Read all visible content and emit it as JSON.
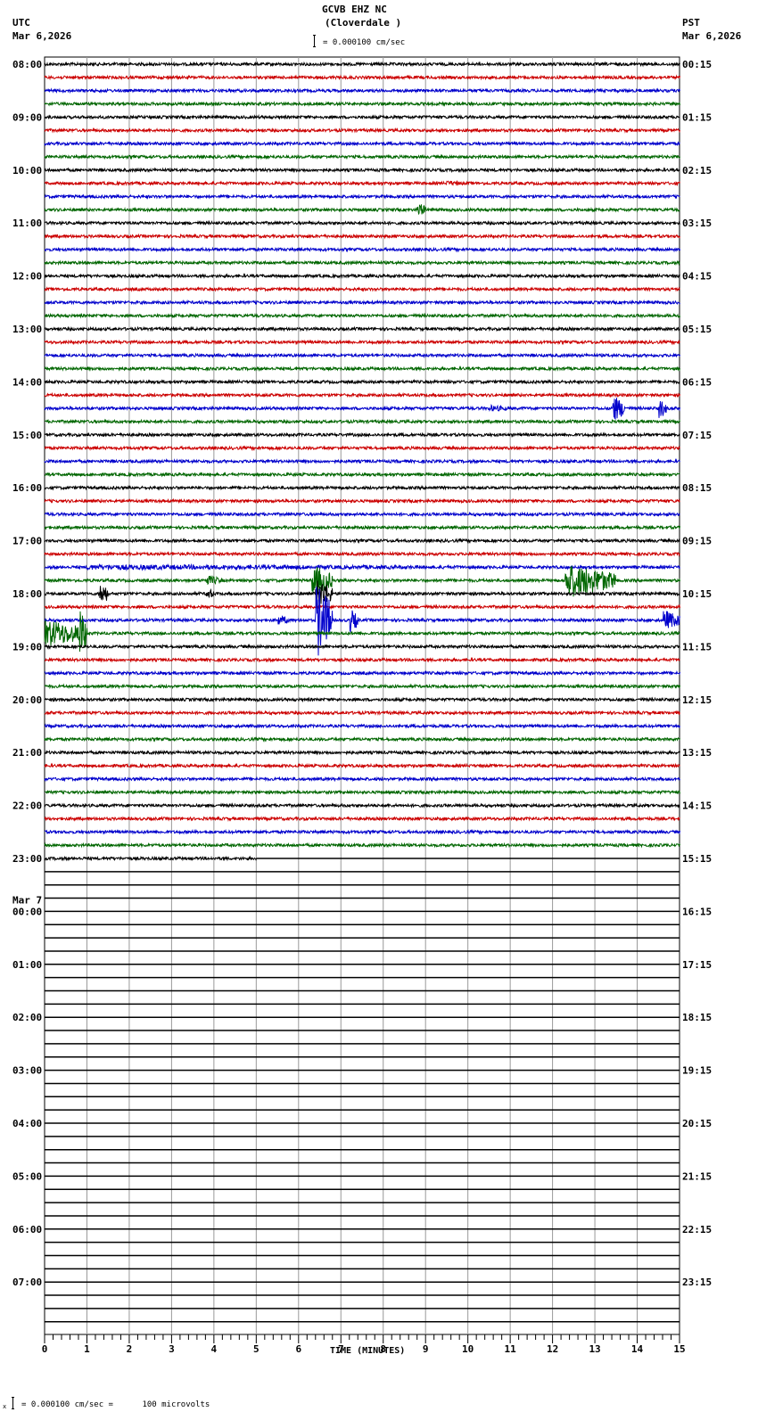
{
  "header": {
    "station": "GCVB EHZ NC",
    "location": "(Cloverdale )",
    "left_tz": "UTC",
    "left_date": "Mar 6,2026",
    "right_tz": "PST",
    "right_date": "Mar 6,2026",
    "scale": "= 0.000100 cm/sec"
  },
  "footer": {
    "scale": "= 0.000100 cm/sec =      100 microvolts",
    "prefix": "x"
  },
  "chart_data": {
    "type": "line",
    "subtype": "helicorder",
    "title": "GCVB EHZ NC (Cloverdale )",
    "xlabel": "TIME (MINUTES)",
    "xlim": [
      0,
      15
    ],
    "x_ticks": [
      "0",
      "1",
      "2",
      "3",
      "4",
      "5",
      "6",
      "7",
      "8",
      "9",
      "10",
      "11",
      "12",
      "13",
      "14",
      "15"
    ],
    "rows_total": 96,
    "rows_per_hour": 4,
    "trace_colors": [
      "#000000",
      "#cc0000",
      "#0000cc",
      "#006600"
    ],
    "rows_with_data": 61,
    "last_row_end_minute": 5,
    "left_labels": [
      {
        "row": 0,
        "text": "08:00"
      },
      {
        "row": 4,
        "text": "09:00"
      },
      {
        "row": 8,
        "text": "10:00"
      },
      {
        "row": 12,
        "text": "11:00"
      },
      {
        "row": 16,
        "text": "12:00"
      },
      {
        "row": 20,
        "text": "13:00"
      },
      {
        "row": 24,
        "text": "14:00"
      },
      {
        "row": 28,
        "text": "15:00"
      },
      {
        "row": 32,
        "text": "16:00"
      },
      {
        "row": 36,
        "text": "17:00"
      },
      {
        "row": 40,
        "text": "18:00"
      },
      {
        "row": 44,
        "text": "19:00"
      },
      {
        "row": 48,
        "text": "20:00"
      },
      {
        "row": 52,
        "text": "21:00"
      },
      {
        "row": 56,
        "text": "22:00"
      },
      {
        "row": 60,
        "text": "23:00"
      },
      {
        "row": 64,
        "text": "00:00",
        "date": "Mar 7"
      },
      {
        "row": 68,
        "text": "01:00"
      },
      {
        "row": 72,
        "text": "02:00"
      },
      {
        "row": 76,
        "text": "03:00"
      },
      {
        "row": 80,
        "text": "04:00"
      },
      {
        "row": 84,
        "text": "05:00"
      },
      {
        "row": 88,
        "text": "06:00"
      },
      {
        "row": 92,
        "text": "07:00"
      }
    ],
    "right_labels": [
      {
        "row": 0,
        "text": "00:15"
      },
      {
        "row": 4,
        "text": "01:15"
      },
      {
        "row": 8,
        "text": "02:15"
      },
      {
        "row": 12,
        "text": "03:15"
      },
      {
        "row": 16,
        "text": "04:15"
      },
      {
        "row": 20,
        "text": "05:15"
      },
      {
        "row": 24,
        "text": "06:15"
      },
      {
        "row": 28,
        "text": "07:15"
      },
      {
        "row": 32,
        "text": "08:15"
      },
      {
        "row": 36,
        "text": "09:15"
      },
      {
        "row": 40,
        "text": "10:15"
      },
      {
        "row": 44,
        "text": "11:15"
      },
      {
        "row": 48,
        "text": "12:15"
      },
      {
        "row": 52,
        "text": "13:15"
      },
      {
        "row": 56,
        "text": "14:15"
      },
      {
        "row": 60,
        "text": "15:15"
      },
      {
        "row": 64,
        "text": "16:15"
      },
      {
        "row": 68,
        "text": "17:15"
      },
      {
        "row": 72,
        "text": "18:15"
      },
      {
        "row": 76,
        "text": "19:15"
      },
      {
        "row": 80,
        "text": "20:15"
      },
      {
        "row": 84,
        "text": "21:15"
      },
      {
        "row": 88,
        "text": "22:15"
      },
      {
        "row": 92,
        "text": "23:15"
      }
    ],
    "events": [
      {
        "row": 9,
        "minute": 9.5,
        "duration": 0.5,
        "amplitude": 3
      },
      {
        "row": 11,
        "minute": 8.8,
        "duration": 0.2,
        "amplitude": 9
      },
      {
        "row": 26,
        "minute": 10.5,
        "duration": 0.5,
        "amplitude": 4
      },
      {
        "row": 26,
        "minute": 13.4,
        "duration": 0.3,
        "amplitude": 16
      },
      {
        "row": 26,
        "minute": 14.5,
        "duration": 0.2,
        "amplitude": 12
      },
      {
        "row": 38,
        "minute": 1.0,
        "duration": 13,
        "amplitude": 3
      },
      {
        "row": 39,
        "minute": 6.3,
        "duration": 0.5,
        "amplitude": 18
      },
      {
        "row": 39,
        "minute": 12.3,
        "duration": 1.2,
        "amplitude": 20
      },
      {
        "row": 39,
        "minute": 3.8,
        "duration": 0.4,
        "amplitude": 6
      },
      {
        "row": 40,
        "minute": 1.3,
        "duration": 0.2,
        "amplitude": 14
      },
      {
        "row": 40,
        "minute": 6.4,
        "duration": 0.4,
        "amplitude": 18
      },
      {
        "row": 40,
        "minute": 3.8,
        "duration": 0.2,
        "amplitude": 7
      },
      {
        "row": 42,
        "minute": 6.4,
        "duration": 0.4,
        "amplitude": 45
      },
      {
        "row": 42,
        "minute": 7.2,
        "duration": 0.2,
        "amplitude": 14
      },
      {
        "row": 42,
        "minute": 14.6,
        "duration": 0.4,
        "amplitude": 12
      },
      {
        "row": 42,
        "minute": 5.5,
        "duration": 0.3,
        "amplitude": 6
      },
      {
        "row": 43,
        "minute": 0.0,
        "duration": 1.0,
        "amplitude": 16
      },
      {
        "row": 43,
        "minute": 0.8,
        "duration": 0.2,
        "amplitude": 30
      }
    ]
  }
}
